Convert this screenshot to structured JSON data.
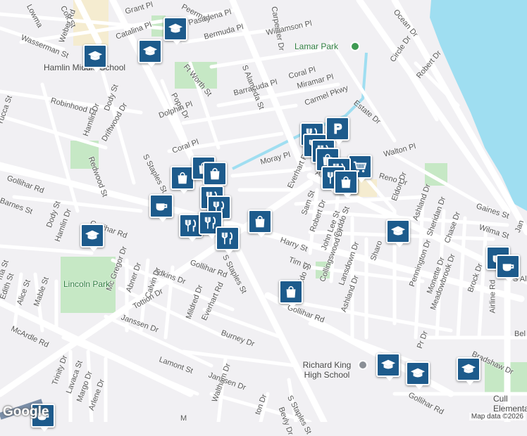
{
  "map": {
    "streets": {
      "ocean_dr": "Ocean Dr",
      "lowman": "Lowma",
      "cott_st": "Cott St",
      "peerman": "Peerman",
      "grant_pl": "Grant Pl",
      "carpenter_dr": "Carpenter Dr",
      "pasadena_pl": "Pasadena Pl",
      "wasserman_st": "Wasserman St",
      "weber_rd": "Weber Rd",
      "catalina_pl": "Catalina Pl",
      "williamson_pl": "Williamson Pl",
      "bermuda_pl": "Bermuda Pl",
      "s_alameda_st": "S Alameda St",
      "ft_worth_st": "Ft Worth St",
      "circle_dr": "Circle Dr",
      "robert_dr_north": "Robert Dr",
      "coral_pl_north": "Coral Pl",
      "pope_dr": "Pope Dr",
      "barracuda_pl": "Barracuda Pl",
      "miramar_pl": "Miramar Pl",
      "robinhood_dr": "Robinhood Dr",
      "dody_st_north": "Dody St",
      "carmel_pkwy": "Carmel Pkwy",
      "estate_dr": "Estate Dr",
      "yucca_st": "Yucca St",
      "hamlin_dr_north": "Hamlin Dr",
      "driftwood_dr": "Driftwood Dr",
      "dolphin_pl": "Dolphin Pl",
      "redwood_st": "Redwood St",
      "s_staples_st_north": "S Staples St",
      "coral_pl": "Coral Pl",
      "walton_pl": "Walton Pl",
      "moray_pl": "Moray Pl",
      "gollihar_rd_west": "Gollihar Rd",
      "everhart_rd_north": "Everhart Rd",
      "avalon_st": "Avalon St",
      "reno_dr": "Reno Dr",
      "eldon_dr": "Eldon Dr",
      "gaines_st": "Gaines St",
      "barnes_st": "Barnes St",
      "sam_st": "Sam St",
      "robert_dr": "Robert Dr",
      "ashland_dr_north": "Ashland Dr",
      "sheridan_dr": "Sheridan Dr",
      "wilma_st": "Wilma St",
      "jan": "Jan",
      "dody_st": "Dody St",
      "gollihar_rd_mid": "Gollihar Rd",
      "hamlin_dr": "Hamlin Dr",
      "chase_dr": "Chase Dr",
      "john_lee_st": "John Lee St",
      "caddo_st_north": "Caddo St",
      "harry_st": "Harry St",
      "sharon": "Sharo",
      "adkins_dr": "Adkins Dr",
      "gollihar_rd_south": "Gollihar Rd",
      "s_staples_st_mid": "S Staples St",
      "tim_ln": "Tim Ln",
      "collingswood_dr": "Collingswood Dr",
      "pennington_dr": "Pennington Dr",
      "monette_dr": "Monette Dr",
      "meadowbrook_dr": "Meadowbrook Dr",
      "brock_dr": "Brock Dr",
      "s_al": "S Al",
      "mc_gregor_dr": "Mc Gregor Dr",
      "abner_dr": "Abner Dr",
      "calvin_dr": "Calvin Dr",
      "everhart_rd": "Everhart Rd",
      "edith_st": "Edith St",
      "alice_st": "Alice St",
      "ma_st": "ma St",
      "tottion_dr": "Tottion Dr",
      "mable_st": "Mable St",
      "caddo_st": "Caddo St",
      "lansdown_dr": "Lansdown Dr",
      "ashland_dr": "Ashland Dr",
      "airline_rd": "Airline Rd",
      "bel": "Bel",
      "janssen_dr_west": "Janssen Dr",
      "mildred_dr": "Mildred Dr",
      "gollihar_rd_east": "Gollihar Rd",
      "mcardle_rd": "McArdle Rd",
      "burney_dr": "Burney Dr",
      "lamont_st": "Lamont St",
      "janssen_dr": "Janssen Dr",
      "bradshaw_dr": "Bradshaw Dr",
      "trinity_dr": "Trinity Dr",
      "lavaca_st": "Lavaca St",
      "margo_dr": "Margo Dr",
      "arlene_dr": "Arlene Dr",
      "waltham_dr": "Waltham Dr",
      "bevly_dr": "Bevly Dr",
      "s_staples_st_south": "S Staples St",
      "gollihar_rd_far": "Gollihar Rd",
      "pr_dr": "Pr Dr",
      "ton_dr": "ton Dr",
      "m_partial": "M"
    },
    "places": {
      "lamar_park": "Lamar Park",
      "hamlin_middle_school": "Hamlin Middle School",
      "lincoln_park": "Lincoln Park",
      "richard_king_high_school": "Richard King High School",
      "cullen_elementary": "Cull Elementar"
    },
    "poi_icons": [
      "school-icon",
      "restaurant-icon",
      "shopping-bag-icon",
      "coffee-cup-icon",
      "grocery-cart-icon",
      "bar-icon"
    ],
    "colors": {
      "poi_fill": "#1d5b8c",
      "water": "#9fdef1",
      "park": "#c6e8c5",
      "school_area": "#f5ecd0",
      "road": "#ffffff",
      "background": "#f1f0f3"
    }
  },
  "attribution": {
    "logo": "Google",
    "map_data": "Map data ©2026"
  }
}
